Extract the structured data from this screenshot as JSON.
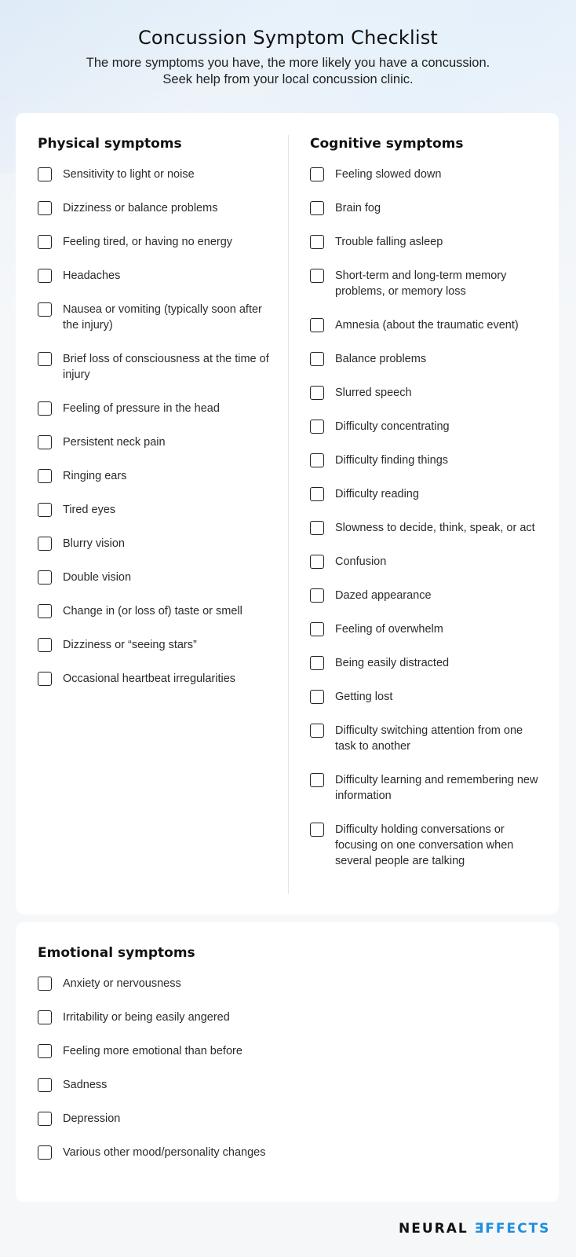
{
  "header": {
    "title": "Concussion Symptom Checklist",
    "subtitle_line1": "The more symptoms you have, the more likely you have a concussion.",
    "subtitle_line2": "Seek help from your local concussion clinic."
  },
  "physical": {
    "title": "Physical symptoms",
    "items": [
      {
        "label": "Sensitivity to light or noise",
        "checked": false
      },
      {
        "label": "Dizziness or balance problems",
        "checked": false
      },
      {
        "label": "Feeling tired, or having no energy",
        "checked": false
      },
      {
        "label": "Headaches",
        "checked": false
      },
      {
        "label": "Nausea or vomiting (typically soon after the injury)",
        "checked": false
      },
      {
        "label": "Brief loss of consciousness at the time of injury",
        "checked": false
      },
      {
        "label": "Feeling of pressure in the head",
        "checked": false
      },
      {
        "label": "Persistent neck pain",
        "checked": false
      },
      {
        "label": "Ringing ears",
        "checked": false
      },
      {
        "label": "Tired eyes",
        "checked": false
      },
      {
        "label": "Blurry vision",
        "checked": false
      },
      {
        "label": "Double vision",
        "checked": false
      },
      {
        "label": "Change in (or loss of) taste or smell",
        "checked": false
      },
      {
        "label": "Dizziness or “seeing stars”",
        "checked": false
      },
      {
        "label": "Occasional heartbeat irregularities",
        "checked": false
      }
    ]
  },
  "cognitive": {
    "title": "Cognitive symptoms",
    "items": [
      {
        "label": "Feeling slowed down",
        "checked": false
      },
      {
        "label": "Brain fog",
        "checked": false
      },
      {
        "label": "Trouble falling asleep",
        "checked": false
      },
      {
        "label": "Short-term and long-term memory problems, or memory loss",
        "checked": false
      },
      {
        "label": "Amnesia (about the traumatic event)",
        "checked": false
      },
      {
        "label": "Balance problems",
        "checked": false
      },
      {
        "label": "Slurred speech",
        "checked": false
      },
      {
        "label": "Difficulty concentrating",
        "checked": false
      },
      {
        "label": "Difficulty finding things",
        "checked": false
      },
      {
        "label": "Difficulty reading",
        "checked": false
      },
      {
        "label": "Slowness to decide, think, speak, or act",
        "checked": false
      },
      {
        "label": "Confusion",
        "checked": false
      },
      {
        "label": "Dazed appearance",
        "checked": false
      },
      {
        "label": "Feeling of overwhelm",
        "checked": false
      },
      {
        "label": "Being easily distracted",
        "checked": false
      },
      {
        "label": "Getting lost",
        "checked": false
      },
      {
        "label": "Difficulty switching attention from one task to another",
        "checked": false
      },
      {
        "label": "Difficulty learning and remembering new information",
        "checked": false
      },
      {
        "label": "Difficulty holding conversations or focusing on one conversation when several people are talking",
        "checked": false
      }
    ]
  },
  "emotional": {
    "title": "Emotional symptoms",
    "items": [
      {
        "label": "Anxiety or nervousness",
        "checked": false
      },
      {
        "label": "Irritability or being easily angered",
        "checked": false
      },
      {
        "label": "Feeling more emotional than before",
        "checked": false
      },
      {
        "label": "Sadness",
        "checked": false
      },
      {
        "label": "Depression",
        "checked": false
      },
      {
        "label": "Various other mood/personality changes",
        "checked": false
      }
    ]
  },
  "logo": {
    "word1": "NEURAL",
    "word2": "ƎFFECTS",
    "accent_color": "#1e8fe0"
  }
}
